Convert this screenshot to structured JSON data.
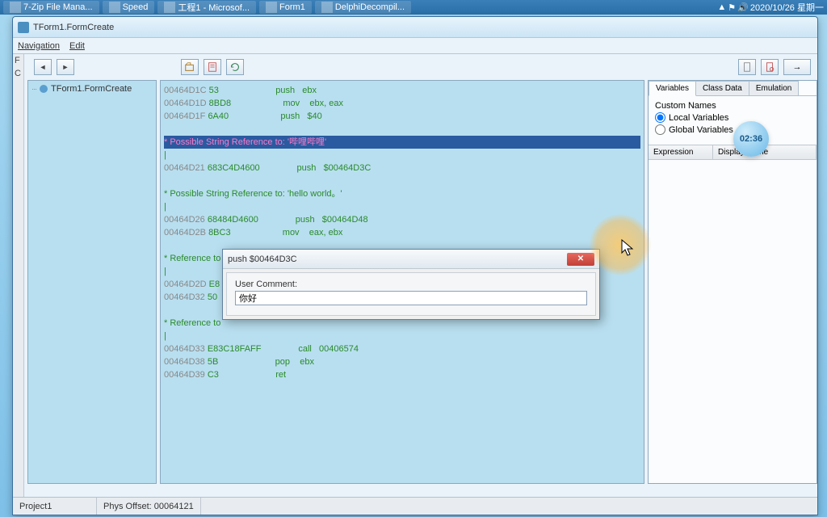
{
  "taskbar": {
    "items": [
      "7-Zip File Mana...",
      "Speed",
      "工程1 - Microsof...",
      "Form1",
      "DelphiDecompil..."
    ],
    "datetime": "2020/10/26 星期一"
  },
  "window": {
    "title": "TForm1.FormCreate"
  },
  "menu": {
    "navigation": "Navigation",
    "edit": "Edit"
  },
  "left_strip": {
    "f": "F",
    "c": "C"
  },
  "tree": {
    "item": "TForm1.FormCreate"
  },
  "disasm": {
    "lines": [
      {
        "addr": "00464D1C",
        "bytes": "53",
        "mnem": "push",
        "ops": "ebx"
      },
      {
        "addr": "00464D1D",
        "bytes": "8BD8",
        "mnem": "mov",
        "ops": "ebx, eax"
      },
      {
        "addr": "00464D1F",
        "bytes": "6A40",
        "mnem": "push",
        "ops": "$40"
      }
    ],
    "highlight": "* Possible String Reference to: '哔哩哔哩'",
    "pipe": "|",
    "line_push1": {
      "addr": "00464D21",
      "bytes": "683C4D4600",
      "mnem": "push",
      "ops": "$00464D3C"
    },
    "comment2": "* Possible String Reference to: 'hello world。'",
    "line_push2": {
      "addr": "00464D26",
      "bytes": "68484D4600",
      "mnem": "push",
      "ops": "$00464D48"
    },
    "line_mov": {
      "addr": "00464D2B",
      "bytes": "8BC3",
      "mnem": "mov",
      "ops": "eax, ebx"
    },
    "comment3": "* Reference to",
    "line_e8a": {
      "addr": "00464D2D",
      "bytes": "E8"
    },
    "line_50": {
      "addr": "00464D32",
      "bytes": "50"
    },
    "comment4": "* Reference to",
    "line_call": {
      "addr": "00464D33",
      "bytes": "E83C18FAFF",
      "mnem": "call",
      "ops": "00406574"
    },
    "line_pop": {
      "addr": "00464D38",
      "bytes": "5B",
      "mnem": "pop",
      "ops": "ebx"
    },
    "line_ret": {
      "addr": "00464D39",
      "bytes": "C3",
      "mnem": "ret",
      "ops": ""
    }
  },
  "right": {
    "tabs": {
      "vars": "Variables",
      "class": "Class Data",
      "emu": "Emulation"
    },
    "custom_names": "Custom Names",
    "local": "Local Variables",
    "global": "Global Variables",
    "colExpr": "Expression",
    "colDisp": "Display Name"
  },
  "clock": "02:36",
  "dialog": {
    "title": "push   $00464D3C",
    "label": "User Comment:",
    "value": "你好"
  },
  "status": {
    "project": "Project1",
    "offset": "Phys Offset: 00064121"
  }
}
